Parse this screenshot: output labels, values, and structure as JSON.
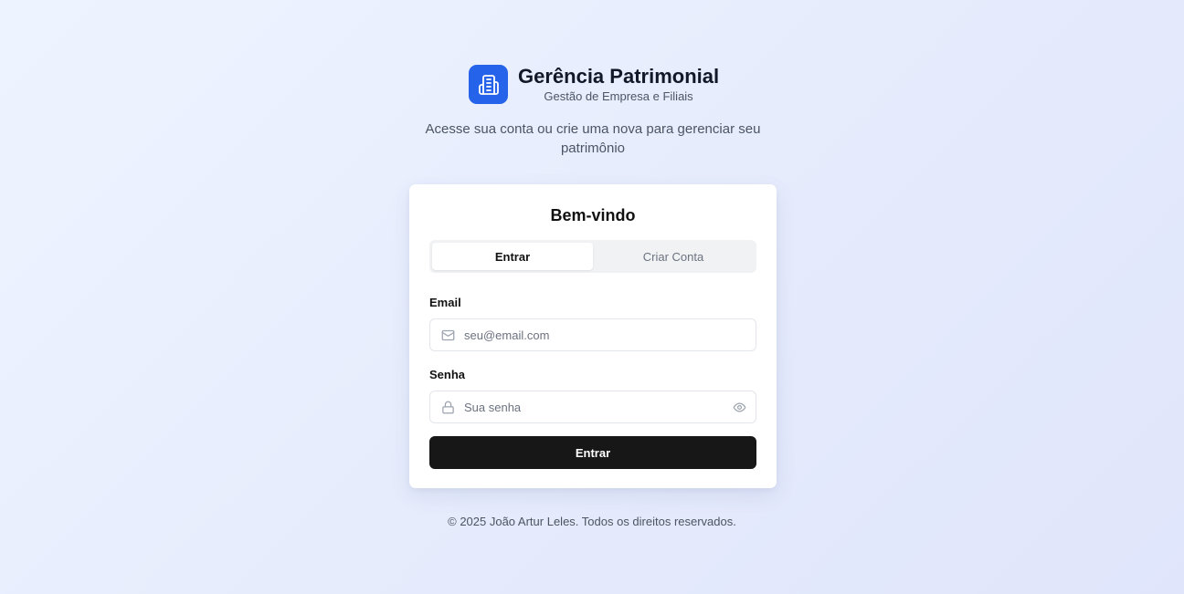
{
  "brand": {
    "title": "Gerência Patrimonial",
    "subtitle": "Gestão de Empresa e Filiais",
    "logo_icon": "building-icon",
    "accent": "#2563eb"
  },
  "tagline": "Acesse sua conta ou crie uma nova para gerenciar seu patrimônio",
  "card": {
    "title": "Bem-vindo",
    "tabs": [
      {
        "label": "Entrar",
        "active": true
      },
      {
        "label": "Criar Conta",
        "active": false
      }
    ],
    "email": {
      "label": "Email",
      "placeholder": "seu@email.com",
      "value": "",
      "icon": "mail-icon"
    },
    "password": {
      "label": "Senha",
      "placeholder": "Sua senha",
      "value": "",
      "icon": "lock-icon",
      "toggle_icon": "eye-icon"
    },
    "submit_label": "Entrar",
    "submit_color": "#171717"
  },
  "footer": "© 2025 João Artur Leles. Todos os direitos reservados."
}
